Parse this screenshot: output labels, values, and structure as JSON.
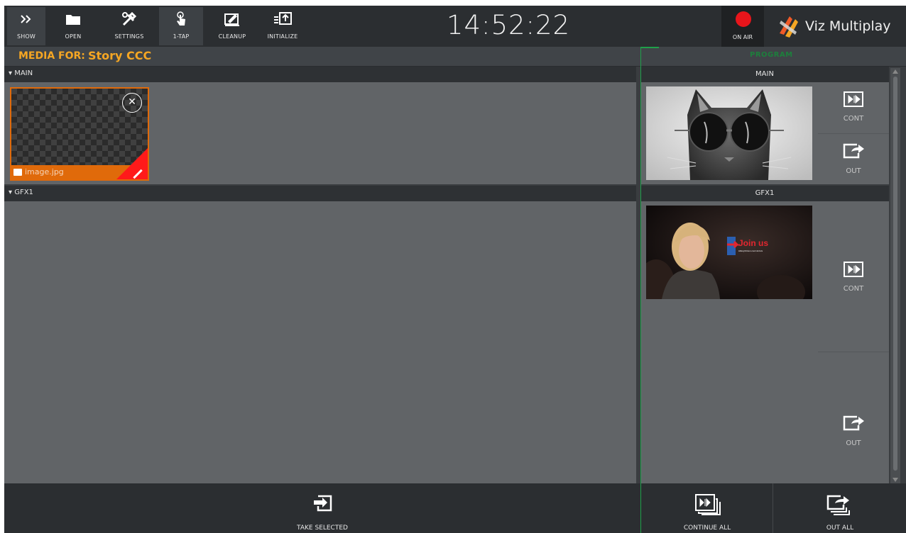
{
  "toolbar": {
    "buttons": [
      {
        "label": "SHOW",
        "icon": "double-chevron-right-icon"
      },
      {
        "label": "OPEN",
        "icon": "folder-icon"
      },
      {
        "label": "SETTINGS",
        "icon": "tools-icon"
      },
      {
        "label": "1-TAP",
        "icon": "tap-hand-icon"
      },
      {
        "label": "CLEANUP",
        "icon": "cleanup-icon"
      },
      {
        "label": "INITIALIZE",
        "icon": "initialize-icon"
      }
    ],
    "clock": "14:52:22",
    "on_air_label": "ON AIR",
    "brand": "Viz Multiplay",
    "colors": {
      "on_air": "#e8151b",
      "accent": "#f5a623",
      "program": "#1fa04a",
      "selected": "#e06a0a"
    }
  },
  "media": {
    "prefix": "MEDIA FOR:",
    "story": "Story CCC",
    "program_label": "PROGRAM"
  },
  "sections": [
    {
      "name": "MAIN",
      "header": "▾ MAIN",
      "preview_header": "MAIN",
      "items": [
        {
          "filename": "image.jpg",
          "selected": true
        }
      ],
      "actions": [
        {
          "label": "CONT"
        },
        {
          "label": "OUT"
        }
      ]
    },
    {
      "name": "GFX1",
      "header": "▾ GFX1",
      "preview_header": "GFX1",
      "preview_text": {
        "headline": "Join us",
        "url": "HillaryClinton.com/JoinUs"
      },
      "actions": [
        {
          "label": "CONT"
        },
        {
          "label": "OUT"
        }
      ]
    }
  ],
  "bottom": {
    "take_selected": "TAKE SELECTED",
    "continue_all": "CONTINUE ALL",
    "out_all": "OUT ALL"
  }
}
